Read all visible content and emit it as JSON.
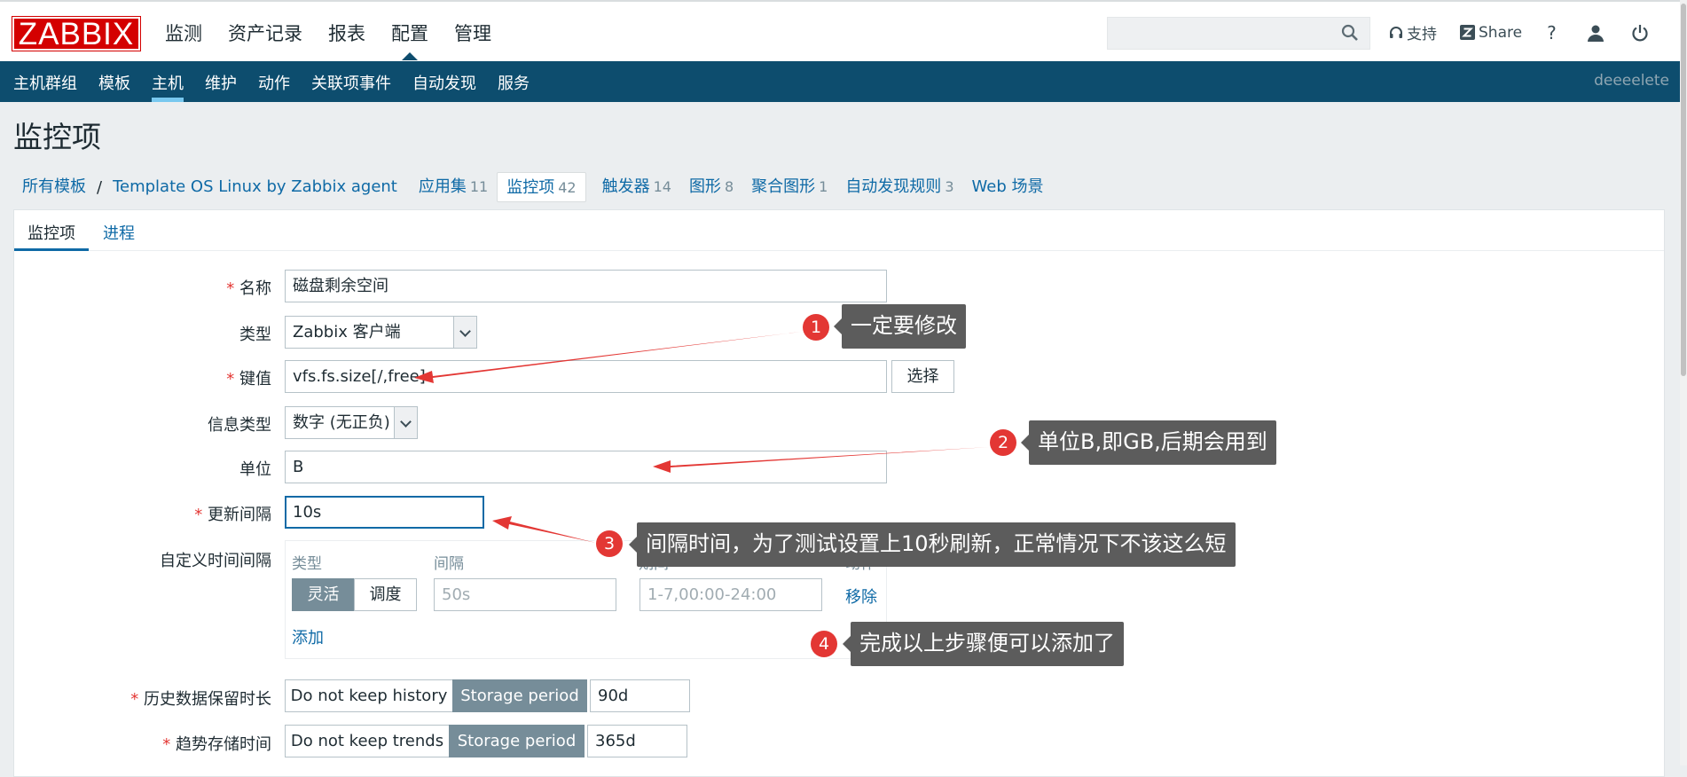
{
  "logo": "ZABBIX",
  "main_menu": [
    "监测",
    "资产记录",
    "报表",
    "配置",
    "管理"
  ],
  "main_menu_active": "配置",
  "search": {
    "placeholder": ""
  },
  "tools": {
    "support": "支持",
    "share": "Share",
    "help": "?"
  },
  "sub_nav": [
    "主机群组",
    "模板",
    "主机",
    "维护",
    "动作",
    "关联项事件",
    "自动发现",
    "服务"
  ],
  "sub_nav_active": "主机",
  "user": "deeeelete",
  "page_title": "监控项",
  "breadcrumbs": {
    "all_templates": "所有模板",
    "separator": "/",
    "template": "Template OS Linux by Zabbix agent",
    "apps": {
      "label": "应用集",
      "count": "11"
    },
    "items": {
      "label": "监控项",
      "count": "42"
    },
    "triggers": {
      "label": "触发器",
      "count": "14"
    },
    "graphs": {
      "label": "图形",
      "count": "8"
    },
    "screens": {
      "label": "聚合图形",
      "count": "1"
    },
    "discovery": {
      "label": "自动发现规则",
      "count": "3"
    },
    "web": {
      "label": "Web 场景"
    }
  },
  "tabs": [
    "监控项",
    "进程"
  ],
  "form": {
    "name_label": "名称",
    "name_value": "磁盘剩余空间",
    "type_label": "类型",
    "type_value": "Zabbix 客户端",
    "key_label": "键值",
    "key_value": "vfs.fs.size[/,free]",
    "select_button": "选择",
    "info_type_label": "信息类型",
    "info_type_value": "数字 (无正负)",
    "units_label": "单位",
    "units_value": "B",
    "interval_label": "更新间隔",
    "interval_value": "10s",
    "custom_label": "自定义时间间隔",
    "custom": {
      "col_type": "类型",
      "col_interval": "间隔",
      "col_period": "期间",
      "col_action": "动作",
      "flexible": "灵活",
      "scheduling": "调度",
      "interval_placeholder": "50s",
      "period_placeholder": "1-7,00:00-24:00",
      "remove": "移除",
      "add": "添加"
    },
    "history_label": "历史数据保留时长",
    "history_no_keep": "Do not keep history",
    "history_storage": "Storage period",
    "history_value": "90d",
    "trends_label": "趋势存储时间",
    "trends_no_keep": "Do not keep trends",
    "trends_storage": "Storage period",
    "trends_value": "365d"
  },
  "annotations": [
    {
      "num": "1",
      "text": "一定要修改"
    },
    {
      "num": "2",
      "text": "单位B,即GB,后期会用到"
    },
    {
      "num": "3",
      "text": "间隔时间，为了测试设置上10秒刷新，正常情况下不该这么短"
    },
    {
      "num": "4",
      "text": "完成以上步骤便可以添加了"
    }
  ],
  "colors": {
    "accent": "#0f6aa6",
    "nav": "#0d4d6e",
    "required": "#e33734",
    "logo": "#d40000",
    "callout": "#5c5c5c"
  }
}
